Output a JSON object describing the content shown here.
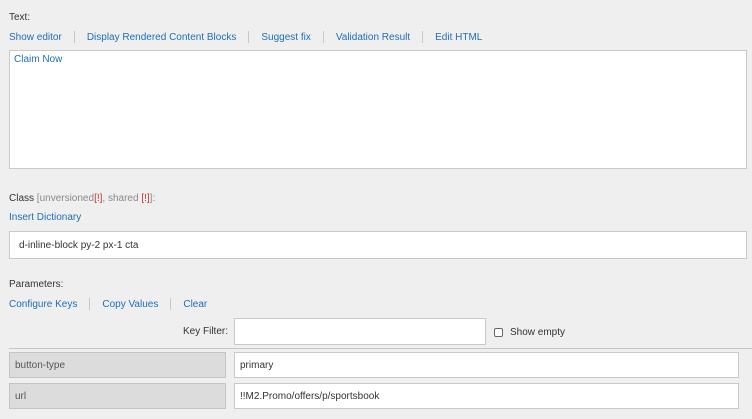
{
  "text_section": {
    "label": "Text:",
    "actions": [
      "Show editor",
      "Display Rendered Content Blocks",
      "Suggest fix",
      "Validation Result",
      "Edit HTML"
    ],
    "content": "Claim Now"
  },
  "class_section": {
    "label_prefix": "Class",
    "unversioned": "[unversioned",
    "unversioned_flag": "[!]",
    "shared": ", shared",
    "shared_flag": "[!]",
    "label_suffix": "]:",
    "insert_dictionary": "Insert Dictionary",
    "value": "d-inline-block py-2 px-1 cta"
  },
  "parameters": {
    "label": "Parameters:",
    "actions": [
      "Configure Keys",
      "Copy Values",
      "Clear"
    ],
    "key_filter_label": "Key Filter:",
    "key_filter_value": "",
    "show_empty_label": "Show empty",
    "rows": [
      {
        "key": "button-type",
        "value": "primary"
      },
      {
        "key": "url",
        "value": "!!M2.Promo/offers/p/sportsbook"
      }
    ]
  },
  "colors": {
    "link": "#1f6fb5",
    "flag": "#c0392b",
    "background": "#efefef"
  }
}
